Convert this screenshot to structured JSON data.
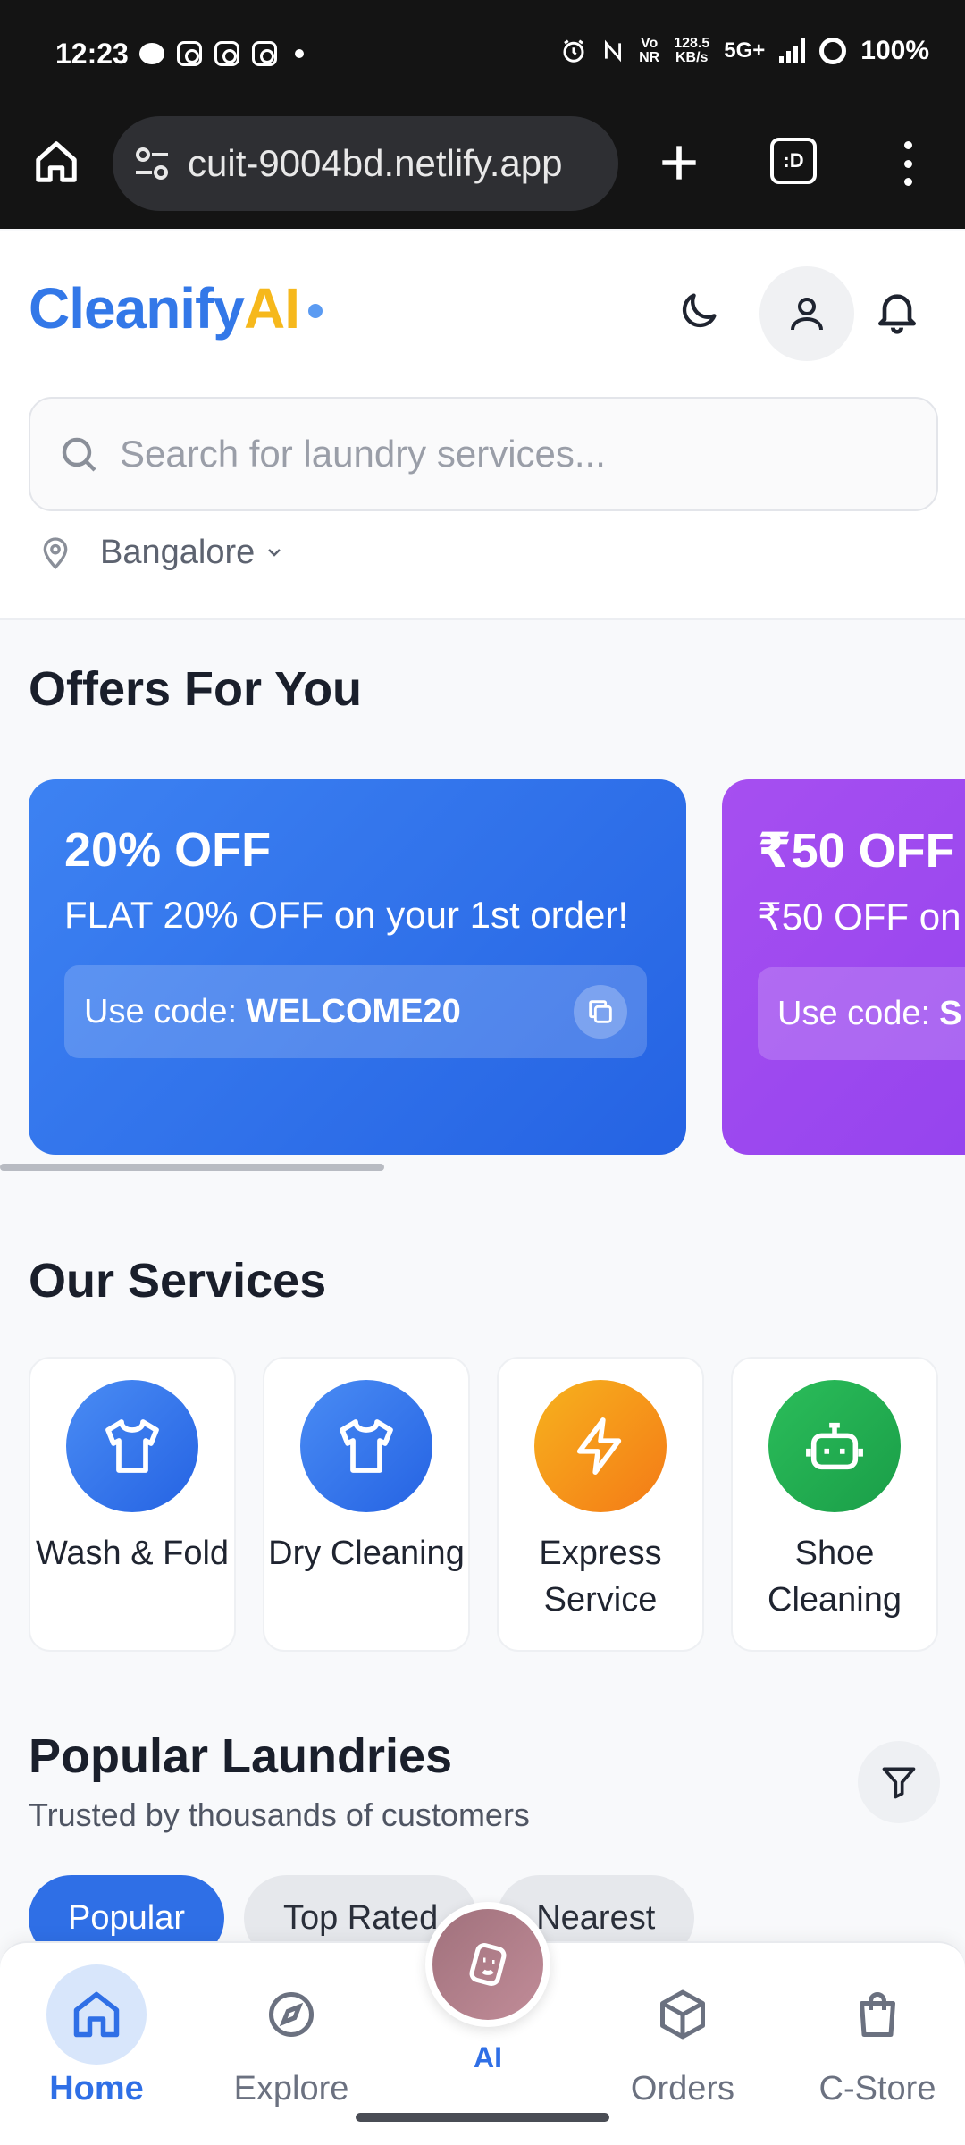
{
  "status_bar": {
    "time": "12:23",
    "net_speed_top": "128.5",
    "net_speed_bottom": "KB/s",
    "network": "5G+",
    "volte_top": "Vo",
    "volte_bottom": "NR",
    "battery": "100%"
  },
  "browser": {
    "url": "cuit-9004bd.netlify.app",
    "tabs_label": ":D"
  },
  "header": {
    "logo_part1": "Cleanify",
    "logo_part2": "AI",
    "search_placeholder": "Search for laundry services...",
    "location": "Bangalore"
  },
  "offers": {
    "title": "Offers For You",
    "items": [
      {
        "headline": "20% OFF",
        "description": "FLAT 20% OFF on your 1st order!",
        "code_prefix": "Use code:",
        "code": "WELCOME20",
        "color": "#2f6fe6"
      },
      {
        "headline": "₹50 OFF",
        "description": "₹50 OFF on",
        "code_prefix": "Use code:",
        "code": "S",
        "color": "#9b46ee"
      }
    ],
    "scroll_progress": 0.4
  },
  "services": {
    "title": "Our Services",
    "items": [
      {
        "label": "Wash & Fold",
        "icon": "shirt-icon",
        "color": "#3378e8"
      },
      {
        "label": "Dry Cleaning",
        "icon": "shirt-icon",
        "color": "#3378e8"
      },
      {
        "label": "Express Service",
        "icon": "lightning-icon",
        "color": "#f59a1b"
      },
      {
        "label": "Shoe Cleaning",
        "icon": "robot-icon",
        "color": "#22ad50"
      }
    ]
  },
  "popular": {
    "title": "Popular Laundries",
    "subtitle": "Trusted by thousands of customers",
    "chips": [
      "Popular",
      "Top Rated",
      "Nearest"
    ],
    "active_chip": "Popular"
  },
  "bottom_nav": {
    "items": [
      {
        "label": "Home",
        "icon": "home-icon",
        "active": true
      },
      {
        "label": "Explore",
        "icon": "compass-icon",
        "active": false
      },
      {
        "label": "AI",
        "icon": "ai-tag-icon",
        "active": false
      },
      {
        "label": "Orders",
        "icon": "box-icon",
        "active": false
      },
      {
        "label": "C-Store",
        "icon": "shopping-bag-icon",
        "active": false
      }
    ]
  },
  "colors": {
    "brand_blue": "#3378e8",
    "brand_yellow": "#f6b81c",
    "active_nav": "#2f6fe6"
  }
}
